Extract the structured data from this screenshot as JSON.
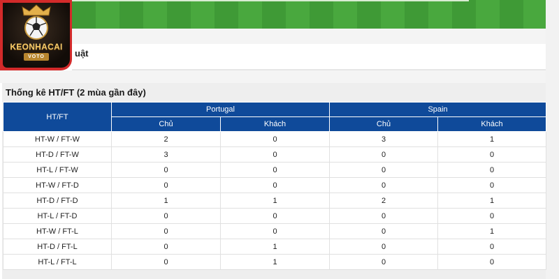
{
  "brand": {
    "name": "KEONHACAI",
    "sub": "VOTO",
    "colors": {
      "frame": "#d32a2a",
      "gold": "#f3c96a"
    }
  },
  "section_partial_label": "uật",
  "stats": {
    "title": "Thống kê HT/FT (2 mùa gần đây)",
    "col_header": "HT/FT",
    "teams": [
      "Portugal",
      "Spain"
    ],
    "subcols": [
      "Chủ",
      "Khách",
      "Chủ",
      "Khách"
    ],
    "header_color": "#0f4a9a",
    "rows": [
      {
        "label": "HT-W / FT-W",
        "v": [
          "2",
          "0",
          "3",
          "1"
        ]
      },
      {
        "label": "HT-D / FT-W",
        "v": [
          "3",
          "0",
          "0",
          "0"
        ]
      },
      {
        "label": "HT-L / FT-W",
        "v": [
          "0",
          "0",
          "0",
          "0"
        ]
      },
      {
        "label": "HT-W / FT-D",
        "v": [
          "0",
          "0",
          "0",
          "0"
        ]
      },
      {
        "label": "HT-D / FT-D",
        "v": [
          "1",
          "1",
          "2",
          "1"
        ]
      },
      {
        "label": "HT-L / FT-D",
        "v": [
          "0",
          "0",
          "0",
          "0"
        ]
      },
      {
        "label": "HT-W / FT-L",
        "v": [
          "0",
          "0",
          "0",
          "1"
        ]
      },
      {
        "label": "HT-D / FT-L",
        "v": [
          "0",
          "1",
          "0",
          "0"
        ]
      },
      {
        "label": "HT-L / FT-L",
        "v": [
          "0",
          "1",
          "0",
          "0"
        ]
      }
    ]
  }
}
